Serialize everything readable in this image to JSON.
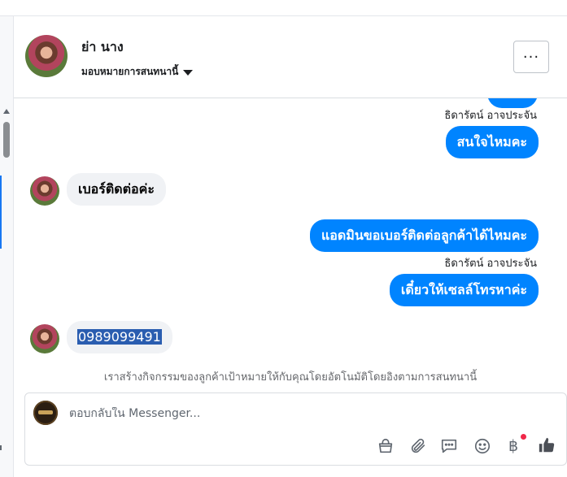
{
  "header": {
    "contact_name": "ย่า นาง",
    "assign_label": "มอบหมายการสนทนานี้",
    "more_label": "···"
  },
  "messages": [
    {
      "type": "sender",
      "text": "ธิดารัตน์ อาจประจัน"
    },
    {
      "type": "outgoing",
      "text": "สนใจไหมคะ"
    },
    {
      "type": "incoming",
      "text": "เบอร์ติดต่อค่ะ"
    },
    {
      "type": "outgoing",
      "text": "แอดมินขอเบอร์ติดต่อลูกค้าได้ไหมคะ"
    },
    {
      "type": "sender",
      "text": "ธิดารัตน์ อาจประจัน"
    },
    {
      "type": "outgoing",
      "text": "เดี๋ยวให้เซลล์โทรหาค่ะ"
    },
    {
      "type": "incoming",
      "text": "0989099491",
      "selected": true
    }
  ],
  "auto_note": "เราสร้างกิจกรรมของลูกค้าเป้าหมายให้กับคุณโดยอัตโนมัติโดยอิงตามการสนทนานี้",
  "composer": {
    "placeholder": "ตอบกลับใน Messenger...",
    "baht_symbol": "฿"
  },
  "icons": [
    "bag-icon",
    "paperclip-icon",
    "chat-bubbles-icon",
    "smiley-icon",
    "baht-icon",
    "thumbs-up-icon"
  ],
  "colors": {
    "outgoing": "#0084ff",
    "incoming": "#f0f2f5",
    "accent": "#1877f2",
    "notification": "#f02849"
  }
}
